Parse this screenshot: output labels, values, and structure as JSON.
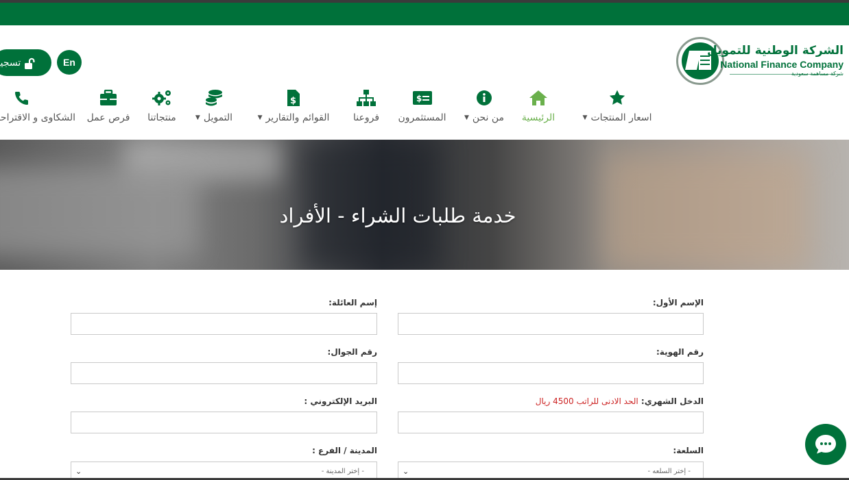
{
  "brand": {
    "name_ar": "الشركة الوطنية للتمويل",
    "name_en": "National Finance Company",
    "subtitle_ar": "شركة مساهمة سعودية",
    "primary_color": "#00713a",
    "accent_color": "#6ab04c"
  },
  "header": {
    "login_label": "تسجيل",
    "login_icon": "unlock-icon",
    "lang_label": "En"
  },
  "nav": {
    "items": [
      {
        "label": "اسعار المنتجات",
        "icon": "star-icon",
        "dropdown": true
      },
      {
        "label": "الرئيسية",
        "icon": "home-icon",
        "active": true
      },
      {
        "label": "من نحن",
        "icon": "info-icon",
        "dropdown": true
      },
      {
        "label": "المستثمرون",
        "icon": "money-bill-icon"
      },
      {
        "label": "فروعنا",
        "icon": "sitemap-icon"
      },
      {
        "label": "القوائم والتقارير",
        "icon": "file-invoice-dollar-icon",
        "dropdown": true
      },
      {
        "label": "التمويل",
        "icon": "coins-icon",
        "dropdown": true
      },
      {
        "label": "منتجاتنا",
        "icon": "cogs-icon"
      },
      {
        "label": "فرص عمل",
        "icon": "briefcase-icon"
      },
      {
        "label": "الشكاوى و الاقتراحات",
        "icon": "phone-icon"
      }
    ]
  },
  "hero": {
    "title": "خدمة طلبات الشراء - الأفراد"
  },
  "form": {
    "first_name_label": "الإسم الأول:",
    "family_name_label": "إسم العائلة:",
    "id_number_label": "رقم الهوية:",
    "mobile_label": "رقم الجوال:",
    "income_label": "الدخل الشهري:",
    "income_note": "الحد الادنى للراتب 4500 ريال",
    "email_label": "البريد الإلكتروني :",
    "commodity_label": "السلعة:",
    "commodity_placeholder": "- إختر السلعه -",
    "city_label": "المدينة / الفرع :",
    "city_placeholder": "- إختر المدينة -"
  },
  "chat": {
    "icon": "chat-bubble-icon"
  }
}
